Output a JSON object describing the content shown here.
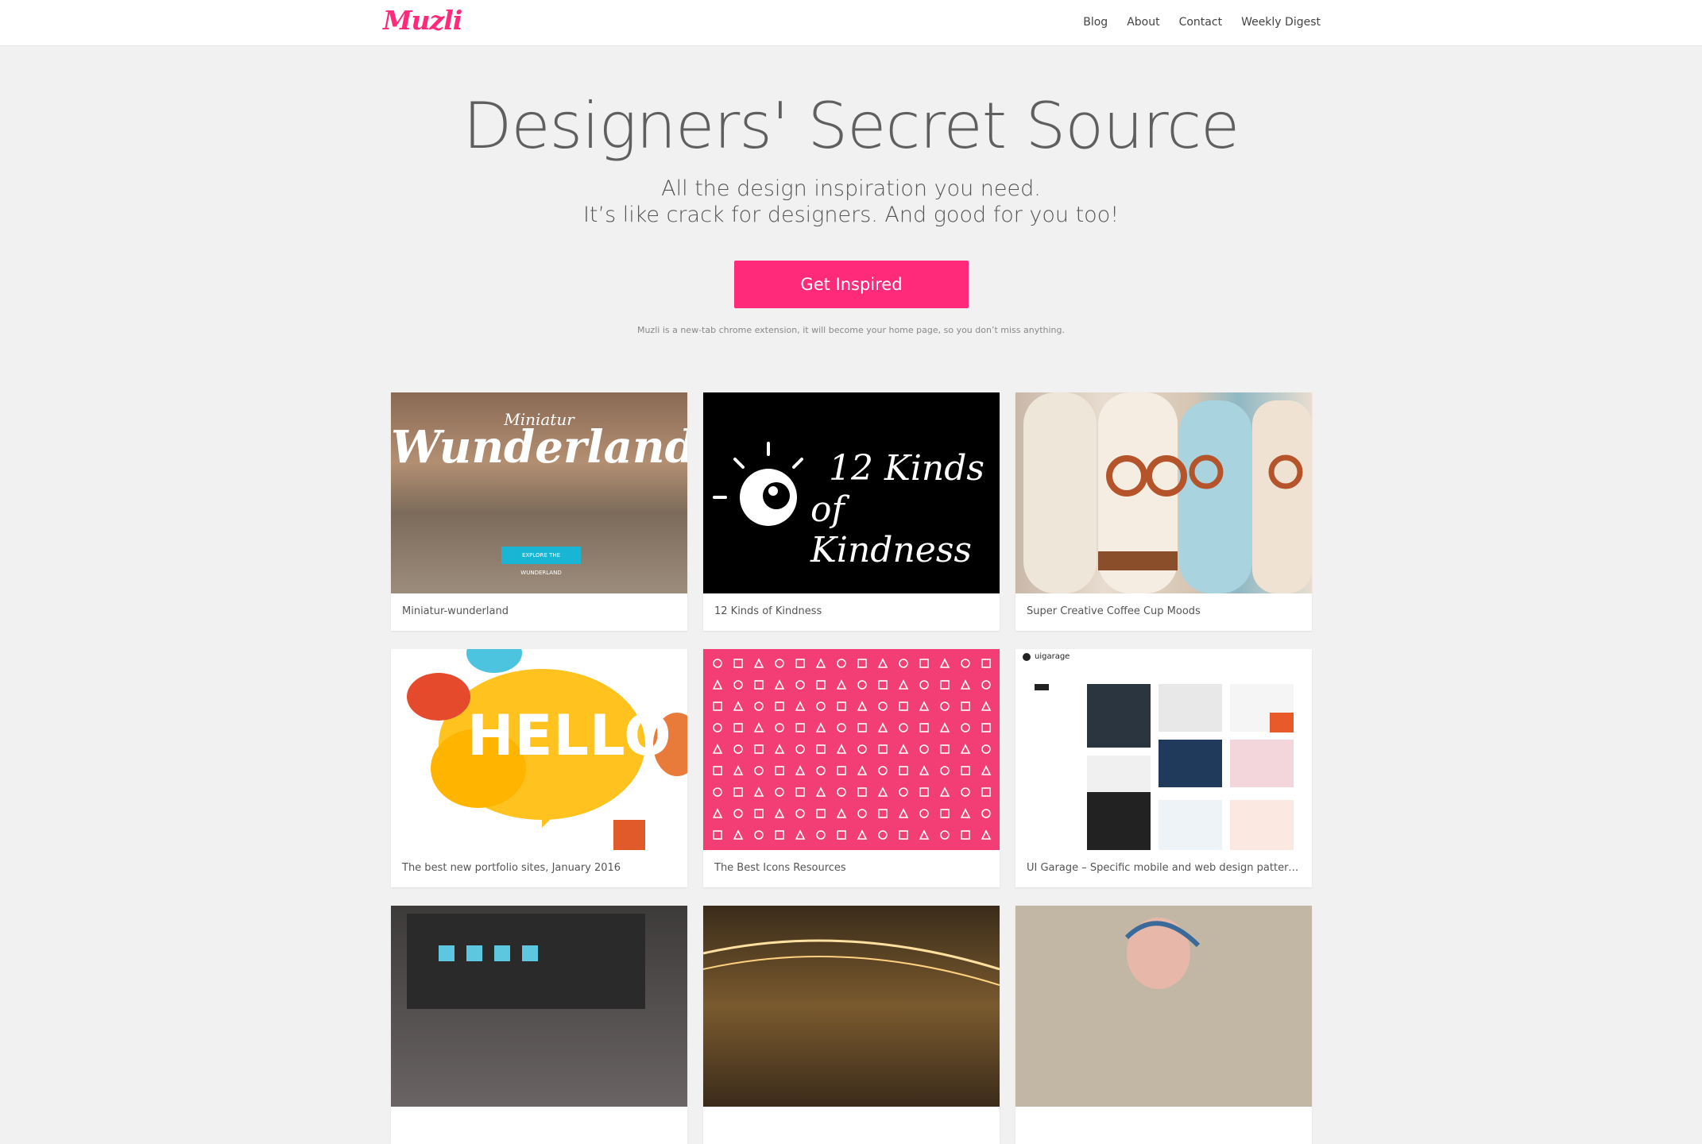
{
  "header": {
    "logo": "Muzli",
    "nav": [
      "Blog",
      "About",
      "Contact",
      "Weekly Digest"
    ]
  },
  "hero": {
    "title": "Designers' Secret Source",
    "subtitle_line1": "All the design inspiration you need.",
    "subtitle_line2": "It’s like crack for designers. And good for you too!",
    "cta": "Get Inspired",
    "note": "Muzli is a new-tab chrome extension, it will become your home page, so you don’t miss anything."
  },
  "cards": [
    {
      "caption": "Miniatur-wunderland",
      "art": {
        "top": "Miniatur",
        "main": "Wunderland",
        "button": "EXPLORE THE WUNDERLAND"
      }
    },
    {
      "caption": "12 Kinds of Kindness",
      "art": {
        "line1": "12 Kinds",
        "line2": "of Kindness"
      }
    },
    {
      "caption": "Super Creative Coffee Cup Moods"
    },
    {
      "caption": "The best new portfolio sites, January 2016",
      "art": {
        "main": "HELLO"
      }
    },
    {
      "caption": "The Best Icons Resources"
    },
    {
      "caption": "UI Garage – Specific mobile and web design patterns f...",
      "art": {
        "brand": "uigarage"
      }
    },
    {
      "caption": ""
    },
    {
      "caption": ""
    },
    {
      "caption": ""
    }
  ],
  "colors": {
    "accent": "#ff2a7a",
    "background": "#f1f1f1"
  }
}
